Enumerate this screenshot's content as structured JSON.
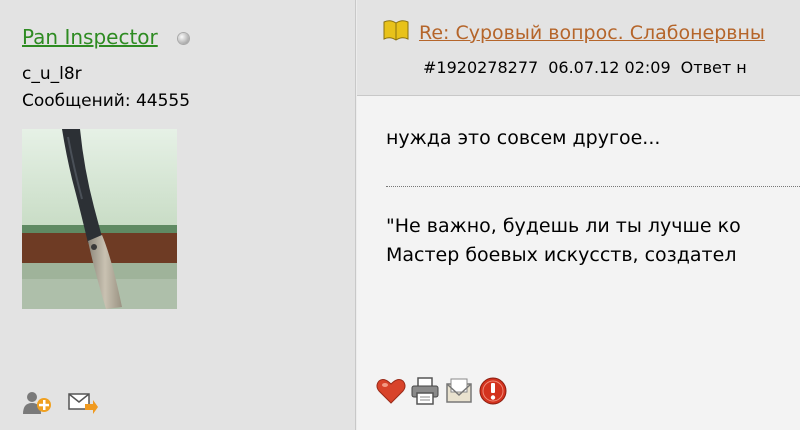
{
  "user": {
    "name": "Pan Inspector",
    "title": "c_u_l8r",
    "posts_text": "Сообщений: 44555",
    "status_icon": "offline-status-icon",
    "sidebar_icons": [
      "add-friend-icon",
      "send-message-icon"
    ]
  },
  "post": {
    "title_icon": "book-icon",
    "title": "Re: Суровый вопрос. Слабонервны",
    "meta": {
      "id": "#1920278277",
      "datetime": "06.07.12 02:09",
      "reply_label": "Ответ н"
    },
    "message": "нужда это совсем другое...",
    "quote_lines": [
      "\"Не важно, будешь ли ты лучше ко",
      "Мастер боевых искусств, создател"
    ],
    "action_icons": [
      "like-heart-icon",
      "print-icon",
      "email-icon",
      "report-icon"
    ]
  },
  "colors": {
    "username": "#2e8b22",
    "title_link": "#b5652a",
    "sidebar_bg": "#e3e3e3",
    "body_bg": "#f3f3f3"
  }
}
